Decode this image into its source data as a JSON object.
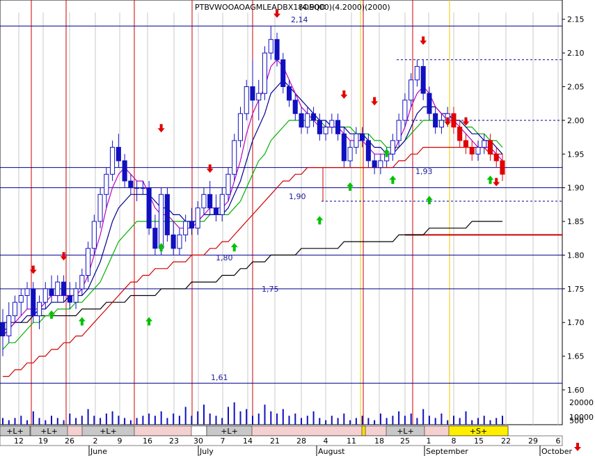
{
  "header": {
    "title": "PTBVWOOAOAGMLEADBX18OEQD",
    "title_overlay": "(4.9000)(4.2000)(2000)"
  },
  "colors": {
    "bull_candle": "#ffffff",
    "bear_candle": "#1010c0",
    "red_candle": "#e00000",
    "ma_fast": "#c000c0",
    "ma_mid": "#00008b",
    "ma_green": "#00b000",
    "ma_red": "#d00000",
    "ma_long": "#000000",
    "level_line": "#00008b",
    "signal_red_line": "#cc0000",
    "signal_yellow_line": "#f0c800",
    "grid": "#c8c8c8",
    "volume": "#1010c0",
    "up_arrow": "#00c000",
    "down_arrow": "#e00000"
  },
  "chart_data": {
    "type": "candlestick",
    "title": "PTBVWOOAOAGMLEADBX18OEQD",
    "y_axis": {
      "side": "right",
      "ylim": [
        1.6,
        2.16
      ],
      "ticks": [
        "2.15",
        "2.10",
        "2.05",
        "2.00",
        "1.95",
        "1.90",
        "1.85",
        "1.80",
        "1.75",
        "1.70",
        "1.65",
        "1.60"
      ]
    },
    "x_axis": {
      "day_ticks": [
        "12",
        "19",
        "26",
        "2",
        "9",
        "16",
        "23",
        "30",
        "7",
        "14",
        "21",
        "28",
        "4",
        "11",
        "18",
        "25",
        "1",
        "8",
        "15",
        "22",
        "29",
        "6"
      ],
      "months": [
        "June",
        "July",
        "August",
        "September",
        "October"
      ]
    },
    "levels": [
      {
        "value": 2.14,
        "label": "2,14"
      },
      {
        "value": 1.93,
        "label": "1,93"
      },
      {
        "value": 1.9,
        "label": "1,90"
      },
      {
        "value": 1.8,
        "label": "1,80"
      },
      {
        "value": 1.75,
        "label": "1,75"
      },
      {
        "value": 1.61,
        "label": "1,61"
      }
    ],
    "dashed_levels": [
      2.09,
      2.0,
      1.88
    ],
    "signal_red_level": 1.83,
    "volume_axis": {
      "labels": [
        "20000",
        "10000",
        "500"
      ]
    },
    "signal_bar": {
      "labels": [
        "+L+",
        "+L+",
        "+L+",
        "+L+",
        "+L+",
        "+S+"
      ]
    },
    "candles": [
      [
        1.7,
        1.72,
        1.65,
        1.68
      ],
      [
        1.68,
        1.73,
        1.67,
        1.71
      ],
      [
        1.71,
        1.74,
        1.7,
        1.73
      ],
      [
        1.73,
        1.75,
        1.71,
        1.74
      ],
      [
        1.74,
        1.76,
        1.72,
        1.75
      ],
      [
        1.75,
        1.76,
        1.7,
        1.71
      ],
      [
        1.71,
        1.74,
        1.69,
        1.73
      ],
      [
        1.73,
        1.76,
        1.72,
        1.75
      ],
      [
        1.75,
        1.77,
        1.73,
        1.74
      ],
      [
        1.74,
        1.77,
        1.73,
        1.76
      ],
      [
        1.76,
        1.77,
        1.73,
        1.74
      ],
      [
        1.74,
        1.76,
        1.72,
        1.73
      ],
      [
        1.73,
        1.76,
        1.72,
        1.75
      ],
      [
        1.75,
        1.78,
        1.74,
        1.77
      ],
      [
        1.77,
        1.82,
        1.76,
        1.81
      ],
      [
        1.81,
        1.86,
        1.8,
        1.85
      ],
      [
        1.85,
        1.9,
        1.84,
        1.89
      ],
      [
        1.89,
        1.93,
        1.87,
        1.92
      ],
      [
        1.92,
        1.97,
        1.91,
        1.96
      ],
      [
        1.96,
        1.98,
        1.93,
        1.94
      ],
      [
        1.94,
        1.95,
        1.9,
        1.91
      ],
      [
        1.91,
        1.92,
        1.89,
        1.9
      ],
      [
        1.9,
        1.91,
        1.88,
        1.9
      ],
      [
        1.9,
        1.91,
        1.89,
        1.9
      ],
      [
        1.9,
        1.91,
        1.83,
        1.84
      ],
      [
        1.84,
        1.86,
        1.8,
        1.81
      ],
      [
        1.81,
        1.9,
        1.8,
        1.89
      ],
      [
        1.89,
        1.9,
        1.82,
        1.83
      ],
      [
        1.83,
        1.85,
        1.8,
        1.81
      ],
      [
        1.81,
        1.84,
        1.8,
        1.83
      ],
      [
        1.83,
        1.86,
        1.82,
        1.85
      ],
      [
        1.85,
        1.87,
        1.83,
        1.84
      ],
      [
        1.84,
        1.88,
        1.83,
        1.87
      ],
      [
        1.87,
        1.9,
        1.86,
        1.89
      ],
      [
        1.89,
        1.91,
        1.86,
        1.87
      ],
      [
        1.87,
        1.89,
        1.85,
        1.86
      ],
      [
        1.86,
        1.9,
        1.85,
        1.89
      ],
      [
        1.89,
        1.93,
        1.88,
        1.92
      ],
      [
        1.92,
        1.98,
        1.91,
        1.97
      ],
      [
        1.97,
        2.02,
        1.96,
        2.01
      ],
      [
        2.01,
        2.06,
        2.0,
        2.05
      ],
      [
        2.05,
        2.09,
        2.02,
        2.03
      ],
      [
        2.03,
        2.06,
        2.0,
        2.04
      ],
      [
        2.04,
        2.11,
        2.03,
        2.1
      ],
      [
        2.1,
        2.14,
        2.09,
        2.12
      ],
      [
        2.12,
        2.13,
        2.08,
        2.09
      ],
      [
        2.09,
        2.1,
        2.04,
        2.05
      ],
      [
        2.05,
        2.06,
        2.02,
        2.03
      ],
      [
        2.03,
        2.04,
        2.0,
        2.01
      ],
      [
        2.01,
        2.02,
        1.98,
        1.99
      ],
      [
        1.99,
        2.02,
        1.98,
        2.01
      ],
      [
        2.01,
        2.02,
        1.99,
        2.0
      ],
      [
        2.0,
        2.01,
        1.97,
        1.98
      ],
      [
        1.98,
        2.0,
        1.97,
        1.99
      ],
      [
        1.99,
        2.01,
        1.98,
        2.0
      ],
      [
        2.0,
        2.01,
        1.97,
        1.98
      ],
      [
        1.98,
        1.99,
        1.93,
        1.94
      ],
      [
        1.94,
        1.97,
        1.93,
        1.96
      ],
      [
        1.96,
        1.99,
        1.95,
        1.98
      ],
      [
        1.98,
        1.99,
        1.96,
        1.97
      ],
      [
        1.97,
        1.98,
        1.93,
        1.94
      ],
      [
        1.94,
        1.95,
        1.92,
        1.93
      ],
      [
        1.93,
        1.95,
        1.92,
        1.94
      ],
      [
        1.94,
        1.96,
        1.93,
        1.95
      ],
      [
        1.95,
        1.98,
        1.94,
        1.97
      ],
      [
        1.97,
        2.01,
        1.96,
        2.0
      ],
      [
        2.0,
        2.04,
        1.99,
        2.03
      ],
      [
        2.03,
        2.07,
        2.02,
        2.06
      ],
      [
        2.06,
        2.09,
        2.05,
        2.08
      ],
      [
        2.08,
        2.09,
        2.03,
        2.04
      ],
      [
        2.04,
        2.05,
        2.0,
        2.01
      ],
      [
        2.01,
        2.02,
        1.98,
        1.99
      ],
      [
        1.99,
        2.01,
        1.98,
        2.0
      ],
      [
        2.0,
        2.02,
        1.99,
        2.01
      ],
      [
        2.01,
        2.02,
        1.98,
        1.99
      ],
      [
        1.99,
        2.0,
        1.96,
        1.97
      ],
      [
        1.97,
        1.98,
        1.95,
        1.96
      ],
      [
        1.96,
        1.97,
        1.94,
        1.95
      ],
      [
        1.95,
        1.97,
        1.94,
        1.96
      ],
      [
        1.96,
        1.98,
        1.95,
        1.97
      ],
      [
        1.97,
        1.98,
        1.94,
        1.95
      ],
      [
        1.95,
        1.96,
        1.93,
        1.94
      ],
      [
        1.94,
        1.95,
        1.91,
        1.92
      ]
    ],
    "ma_fast": [
      1.68,
      1.69,
      1.7,
      1.71,
      1.72,
      1.72,
      1.72,
      1.73,
      1.74,
      1.74,
      1.74,
      1.74,
      1.74,
      1.75,
      1.77,
      1.8,
      1.83,
      1.87,
      1.9,
      1.92,
      1.93,
      1.92,
      1.91,
      1.91,
      1.89,
      1.87,
      1.86,
      1.86,
      1.85,
      1.84,
      1.84,
      1.84,
      1.85,
      1.86,
      1.87,
      1.87,
      1.87,
      1.88,
      1.91,
      1.94,
      1.98,
      2.01,
      2.03,
      2.05,
      2.08,
      2.09,
      2.08,
      2.06,
      2.04,
      2.02,
      2.01,
      2.0,
      1.99,
      1.99,
      1.99,
      1.99,
      1.98,
      1.97,
      1.97,
      1.97,
      1.96,
      1.95,
      1.95,
      1.95,
      1.95,
      1.97,
      1.99,
      2.02,
      2.04,
      2.05,
      2.04,
      2.02,
      2.01,
      2.0,
      2.0,
      1.99,
      1.98,
      1.97,
      1.96,
      1.96,
      1.96,
      1.95,
      1.94
    ],
    "ma_mid": [
      1.69,
      1.69,
      1.7,
      1.7,
      1.71,
      1.71,
      1.72,
      1.72,
      1.73,
      1.73,
      1.73,
      1.74,
      1.74,
      1.74,
      1.75,
      1.77,
      1.79,
      1.82,
      1.85,
      1.87,
      1.88,
      1.89,
      1.89,
      1.89,
      1.89,
      1.88,
      1.87,
      1.87,
      1.86,
      1.86,
      1.85,
      1.85,
      1.85,
      1.86,
      1.86,
      1.86,
      1.86,
      1.87,
      1.89,
      1.91,
      1.94,
      1.97,
      1.99,
      2.01,
      2.04,
      2.05,
      2.06,
      2.05,
      2.04,
      2.03,
      2.02,
      2.01,
      2.0,
      2.0,
      1.99,
      1.99,
      1.99,
      1.98,
      1.98,
      1.98,
      1.97,
      1.96,
      1.96,
      1.95,
      1.95,
      1.96,
      1.97,
      1.99,
      2.01,
      2.02,
      2.02,
      2.02,
      2.01,
      2.01,
      2.0,
      2.0,
      1.99,
      1.98,
      1.98,
      1.97,
      1.97,
      1.96,
      1.95
    ],
    "ma_green": [
      1.66,
      1.67,
      1.67,
      1.68,
      1.69,
      1.7,
      1.7,
      1.71,
      1.71,
      1.72,
      1.72,
      1.72,
      1.73,
      1.73,
      1.74,
      1.75,
      1.76,
      1.78,
      1.8,
      1.82,
      1.83,
      1.84,
      1.85,
      1.85,
      1.85,
      1.85,
      1.85,
      1.85,
      1.85,
      1.85,
      1.85,
      1.85,
      1.85,
      1.85,
      1.86,
      1.86,
      1.86,
      1.86,
      1.87,
      1.88,
      1.9,
      1.92,
      1.94,
      1.95,
      1.97,
      1.98,
      1.99,
      2.0,
      2.0,
      2.0,
      2.0,
      2.0,
      2.0,
      1.99,
      1.99,
      1.99,
      1.99,
      1.99,
      1.98,
      1.98,
      1.98,
      1.97,
      1.97,
      1.96,
      1.96,
      1.96,
      1.97,
      1.98,
      1.99,
      2.0,
      2.0,
      2.0,
      2.0,
      2.0,
      2.0,
      2.0,
      1.99,
      1.99,
      1.98,
      1.98,
      1.97,
      1.97,
      1.96
    ],
    "ma_red": [
      1.62,
      1.62,
      1.63,
      1.63,
      1.64,
      1.64,
      1.65,
      1.65,
      1.66,
      1.66,
      1.67,
      1.67,
      1.68,
      1.68,
      1.69,
      1.7,
      1.71,
      1.72,
      1.73,
      1.74,
      1.75,
      1.76,
      1.76,
      1.77,
      1.77,
      1.78,
      1.78,
      1.78,
      1.79,
      1.79,
      1.79,
      1.8,
      1.8,
      1.8,
      1.81,
      1.81,
      1.82,
      1.82,
      1.83,
      1.84,
      1.85,
      1.86,
      1.87,
      1.88,
      1.89,
      1.9,
      1.91,
      1.91,
      1.92,
      1.92,
      1.93,
      1.93,
      1.93,
      1.93,
      1.93,
      1.93,
      1.93,
      1.93,
      1.93,
      1.93,
      1.93,
      1.93,
      1.93,
      1.93,
      1.93,
      1.94,
      1.94,
      1.95,
      1.95,
      1.96,
      1.96,
      1.96,
      1.96,
      1.96,
      1.96,
      1.96,
      1.96,
      1.96,
      1.96,
      1.96,
      1.95,
      1.95,
      1.95
    ],
    "ma_long": [
      1.7,
      1.7,
      1.7,
      1.7,
      1.7,
      1.71,
      1.71,
      1.71,
      1.71,
      1.71,
      1.71,
      1.71,
      1.71,
      1.72,
      1.72,
      1.72,
      1.72,
      1.73,
      1.73,
      1.73,
      1.73,
      1.74,
      1.74,
      1.74,
      1.74,
      1.74,
      1.75,
      1.75,
      1.75,
      1.75,
      1.75,
      1.76,
      1.76,
      1.76,
      1.76,
      1.76,
      1.77,
      1.77,
      1.77,
      1.78,
      1.78,
      1.79,
      1.79,
      1.79,
      1.8,
      1.8,
      1.8,
      1.8,
      1.8,
      1.81,
      1.81,
      1.81,
      1.81,
      1.81,
      1.81,
      1.81,
      1.82,
      1.82,
      1.82,
      1.82,
      1.82,
      1.82,
      1.82,
      1.82,
      1.82,
      1.83,
      1.83,
      1.83,
      1.83,
      1.83,
      1.84,
      1.84,
      1.84,
      1.84,
      1.84,
      1.84,
      1.84,
      1.85,
      1.85,
      1.85,
      1.85,
      1.85,
      1.85
    ],
    "volume": [
      3,
      2,
      3,
      4,
      2,
      6,
      3,
      2,
      4,
      3,
      2,
      5,
      3,
      4,
      7,
      4,
      3,
      5,
      6,
      4,
      3,
      2,
      3,
      4,
      5,
      4,
      6,
      3,
      5,
      4,
      8,
      4,
      6,
      9,
      5,
      4,
      3,
      8,
      10,
      6,
      7,
      4,
      5,
      9,
      6,
      5,
      7,
      4,
      5,
      3,
      4,
      6,
      3,
      2,
      4,
      3,
      5,
      2,
      3,
      4,
      3,
      2,
      5,
      3,
      4,
      6,
      4,
      5,
      3,
      7,
      4,
      3,
      5,
      2,
      4,
      3,
      6,
      2,
      3,
      4,
      2,
      3,
      4
    ],
    "up_arrows": [
      1.72,
      1.71,
      1.71,
      1.82,
      1.82,
      1.86,
      1.91,
      1.96,
      1.92,
      1.89,
      1.92
    ],
    "down_arrows": [
      1.77,
      1.79,
      1.98,
      1.92,
      2.15,
      2.03,
      2.02,
      2.11,
      1.99,
      1.99,
      1.9
    ]
  }
}
